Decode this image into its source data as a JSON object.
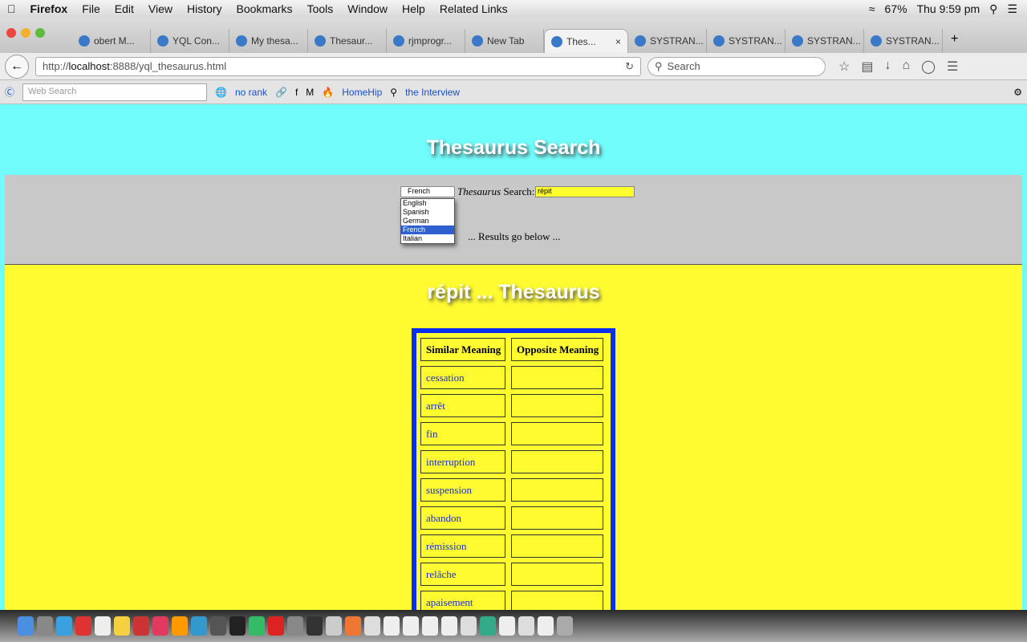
{
  "menubar": {
    "app": "Firefox",
    "items": [
      "File",
      "Edit",
      "View",
      "History",
      "Bookmarks",
      "Tools",
      "Window",
      "Help",
      "Related Links"
    ],
    "battery": "67%",
    "clock": "Thu 9:59 pm"
  },
  "tabs": [
    {
      "label": "obert M..."
    },
    {
      "label": "YQL Con..."
    },
    {
      "label": "My thesa..."
    },
    {
      "label": "Thesaur..."
    },
    {
      "label": "rjmprogr..."
    },
    {
      "label": "New Tab"
    },
    {
      "label": "Thes...",
      "active": true
    },
    {
      "label": "SYSTRAN..."
    },
    {
      "label": "SYSTRAN..."
    },
    {
      "label": "SYSTRAN..."
    },
    {
      "label": "SYSTRAN..."
    }
  ],
  "nav": {
    "url_prefix": "http://",
    "url_host": "localhost",
    "url_rest": ":8888/yql_thesaurus.html",
    "search_placeholder": "Search"
  },
  "toolbar": {
    "web_search_placeholder": "Web Search",
    "no_rank": "no rank",
    "homehip": "HomeHip",
    "interview": "the Interview"
  },
  "page": {
    "title": "Thesaurus Search",
    "language_selected": "French",
    "language_options": [
      "English",
      "Spanish",
      "German",
      "French",
      "Italian"
    ],
    "label_italic": "Thesaurus",
    "label_rest": " Search:",
    "search_value": "répit",
    "results_note": "... Results go below ...",
    "results_title": "répit ... Thesaurus",
    "table": {
      "headers": [
        "Similar Meaning",
        "Opposite Meaning"
      ],
      "similar": [
        "cessation",
        "arrêt",
        "fin",
        "interruption",
        "suspension",
        "abandon",
        "rémission",
        "relâche",
        "apaisement"
      ],
      "opposite": [
        "",
        "",
        "",
        "",
        "",
        "",
        "",
        "",
        ""
      ]
    }
  },
  "colors": {
    "header_bg": "#70fcfb",
    "form_bg": "#c8c8c8",
    "results_bg": "#fffb30",
    "table_border": "#0a2ef0"
  }
}
